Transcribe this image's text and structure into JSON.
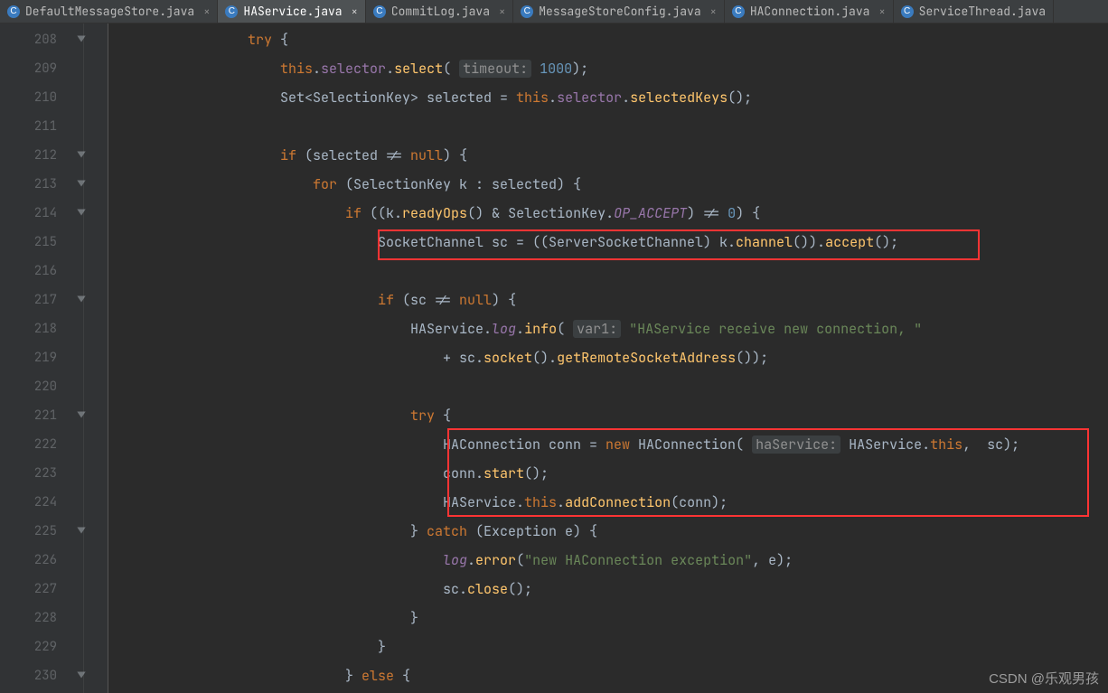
{
  "tabs": [
    {
      "label": "DefaultMessageStore.java",
      "active": false
    },
    {
      "label": "HAService.java",
      "active": true
    },
    {
      "label": "CommitLog.java",
      "active": false
    },
    {
      "label": "MessageStoreConfig.java",
      "active": false
    },
    {
      "label": "HAConnection.java",
      "active": false
    },
    {
      "label": "ServiceThread.java",
      "active": false
    }
  ],
  "gutter": {
    "start": 208,
    "end": 230
  },
  "hints": {
    "timeout": "timeout:",
    "var1": "var1:",
    "haService": "haService:"
  },
  "code": {
    "l208": {
      "kw": "try",
      "brace": " {"
    },
    "l209": {
      "this": "this",
      "dot1": ".",
      "sel": "selector",
      "dot2": ".",
      "m": "select",
      "open": "( ",
      "hint": "timeout:",
      "num": "1000",
      "close": ");"
    },
    "l210": {
      "pre": "Set<SelectionKey> selected = ",
      "this": "this",
      "dot": ".",
      "sel": "selector",
      "dot2": ".",
      "m": "selectedKeys",
      "close": "();"
    },
    "l212": {
      "kw": "if",
      "cond": " (selected != ",
      "null": "null",
      "close": ") {"
    },
    "l213": {
      "kw": "for",
      "cond": " (SelectionKey k : selected) {"
    },
    "l214": {
      "kw": "if",
      "open": " ((k.",
      "m": "readyOps",
      "mid": "() & SelectionKey.",
      "const": "OP_ACCEPT",
      "close": ") != ",
      "zero": "0",
      "end": ") {"
    },
    "l215": {
      "text": "SocketChannel sc = ((ServerSocketChannel) k.",
      "m": "channel",
      "mid": "()).",
      "m2": "accept",
      "close": "();"
    },
    "l217": {
      "kw": "if",
      "cond": " (sc != ",
      "null": "null",
      "close": ") {"
    },
    "l218": {
      "pre": "HAService.",
      "log": "log",
      "dot": ".",
      "m": "info",
      "open": "( ",
      "hint": "var1:",
      "sp": " ",
      "str": "\"HAService receive new connection, \""
    },
    "l219": {
      "pre": "+ sc.",
      "m": "socket",
      "mid": "().",
      "m2": "getRemoteSocketAddress",
      "close": "());"
    },
    "l221": {
      "kw": "try",
      "brace": " {"
    },
    "l222": {
      "pre": "HAConnection conn = ",
      "new": "new",
      "sp": " HAConnection( ",
      "hint": "haService:",
      "sp2": " HAService.",
      "this": "this",
      "close": ",  sc);"
    },
    "l223": {
      "pre": "conn.",
      "m": "start",
      "close": "();"
    },
    "l224": {
      "pre": "HAService.",
      "this": "this",
      "dot": ".",
      "m": "addConnection",
      "close": "(conn);"
    },
    "l225": {
      "brace": "} ",
      "kw": "catch",
      "cond": " (Exception e) {"
    },
    "l226": {
      "log": "log",
      "dot": ".",
      "m": "error",
      "open": "(",
      "str": "\"new HAConnection exception\"",
      "close": ", e);"
    },
    "l227": {
      "pre": "sc.",
      "m": "close",
      "close": "();"
    },
    "l228": {
      "brace": "}"
    },
    "l229": {
      "brace": "}"
    },
    "l230": {
      "brace": "} ",
      "kw": "else",
      "close": " {"
    }
  },
  "indent": {
    "base": 16,
    "i4": "                ",
    "i5": "                    ",
    "i6": "                        ",
    "i7": "                            ",
    "i8": "                                ",
    "i9": "                                    ",
    "i9b": "                                        "
  },
  "watermark": "CSDN @乐观男孩"
}
